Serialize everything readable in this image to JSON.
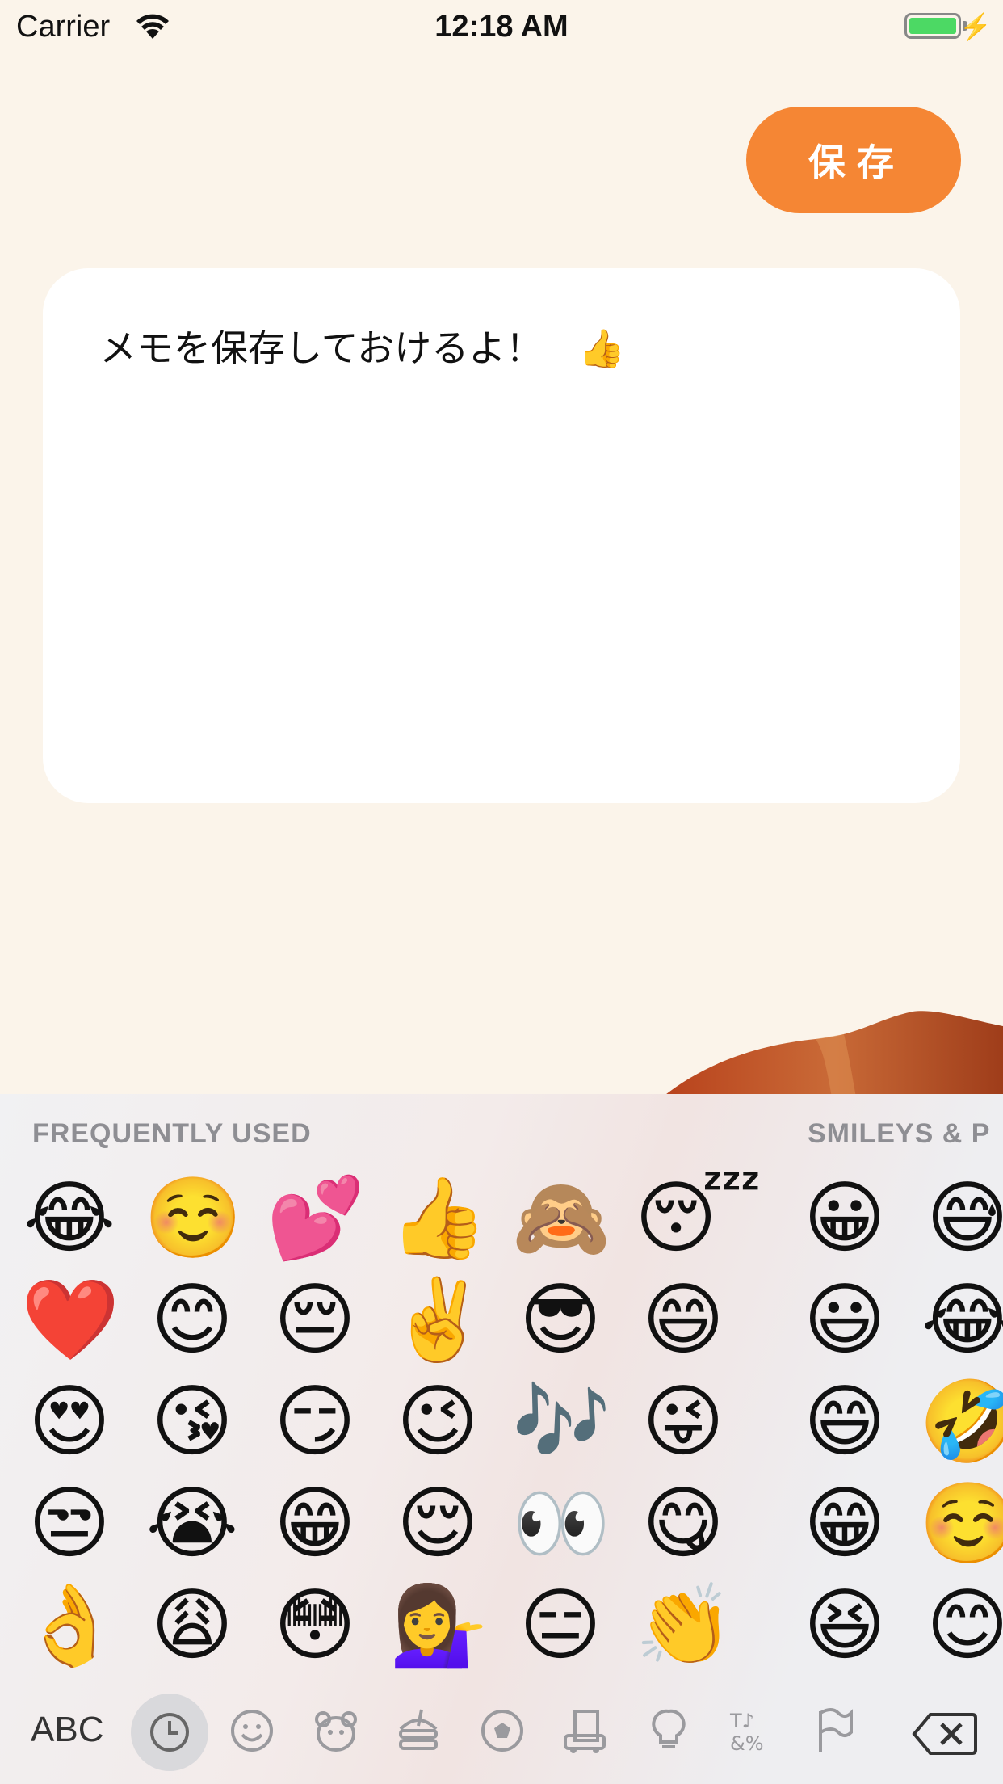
{
  "status_bar": {
    "carrier": "Carrier",
    "time": "12:18 AM"
  },
  "save_button": {
    "label": "保存"
  },
  "memo": {
    "text": "メモを保存しておけるよ！",
    "emoji": "👍"
  },
  "keyboard": {
    "section_frequent": "FREQUENTLY USED",
    "section_smileys": "SMILEYS & P",
    "abc_label": "ABC",
    "emoji_grid": {
      "rows": [
        [
          "😂",
          "☺️",
          "💕",
          "👍",
          "🙈",
          "😴",
          "😀",
          "😅"
        ],
        [
          "❤️",
          "😊",
          "😔",
          "✌️",
          "😎",
          "😄",
          "😃",
          "😂"
        ],
        [
          "😍",
          "😘",
          "😏",
          "😉",
          "🎶",
          "😜",
          "😄",
          "🤣"
        ],
        [
          "😒",
          "😭",
          "😁",
          "😌",
          "👀",
          "😋",
          "😁",
          "☺️"
        ],
        [
          "👌",
          "😩",
          "😳",
          "💁‍♀️",
          "😑",
          "👏",
          "😆",
          "😊"
        ]
      ]
    },
    "categories": [
      "clock-icon",
      "smiley-icon",
      "bear-icon",
      "food-icon",
      "ball-icon",
      "building-icon",
      "bulb-icon",
      "symbols-icon",
      "flag-icon"
    ]
  }
}
